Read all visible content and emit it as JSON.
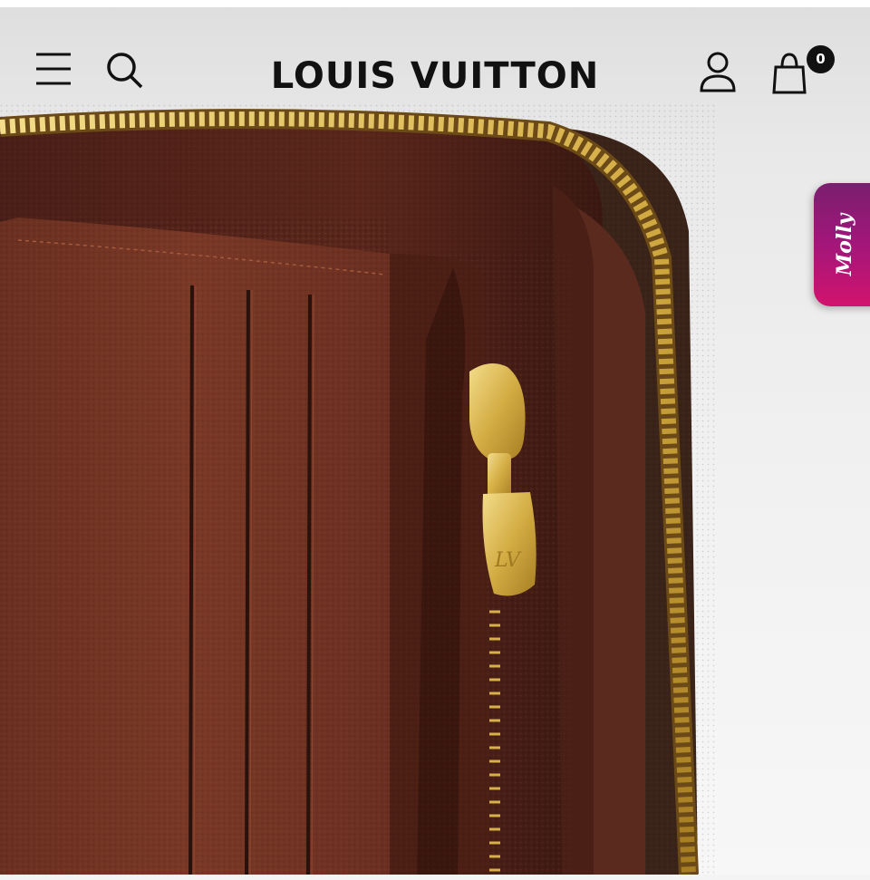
{
  "header": {
    "brand": "LOUIS VUITTON",
    "cart_count": "0",
    "icons": {
      "menu": "menu-icon",
      "search": "search-icon",
      "account": "account-icon",
      "cart": "cart-icon"
    }
  },
  "product": {
    "image_subject": "brown wallet interior with gold zipper"
  },
  "chat_widget": {
    "label": "Molly",
    "colors": [
      "#7a1e6f",
      "#d2136d"
    ]
  },
  "colors": {
    "text": "#111111",
    "leather_brown": "#6b3222",
    "zipper_gold": "#d9b64a"
  }
}
